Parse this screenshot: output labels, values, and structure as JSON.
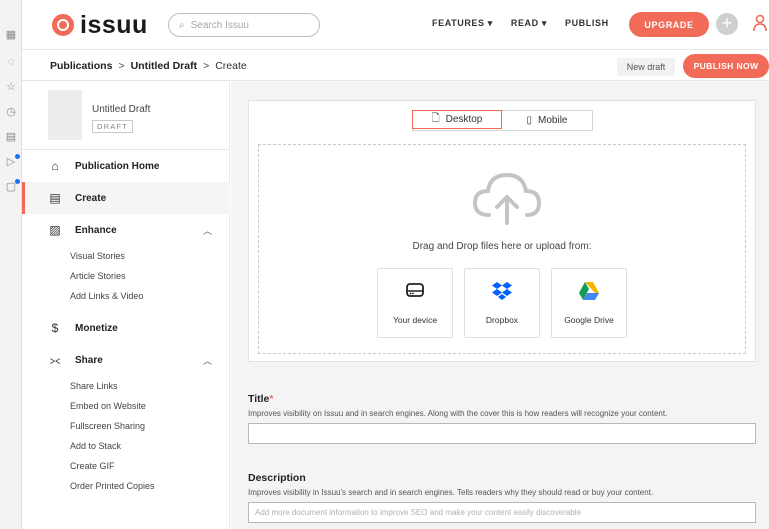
{
  "topbar": {
    "logo_text": "issuu",
    "search_placeholder": "Search Issuu",
    "nav": [
      "FEATURES ▾",
      "READ ▾",
      "PUBLISH"
    ],
    "upgrade_label": "UPGRADE",
    "plus_label": "+"
  },
  "breadcrumb": {
    "items": [
      "Publications",
      "Untitled Draft",
      "Create"
    ],
    "separator": ">"
  },
  "actions": {
    "new_draft_label": "New draft",
    "publish_label": "PUBLISH NOW"
  },
  "publication": {
    "title": "Untitled Draft",
    "badge": "DRAFT"
  },
  "nav": {
    "publication_home": "Publication Home",
    "create": "Create",
    "enhance": "Enhance",
    "enhance_items": [
      "Visual Stories",
      "Article Stories",
      "Add Links & Video"
    ],
    "monetize": "Monetize",
    "share": "Share",
    "share_items": [
      "Share Links",
      "Embed on Website",
      "Fullscreen Sharing",
      "Add to Stack",
      "Create GIF",
      "Order Printed Copies"
    ]
  },
  "upload": {
    "tabs": [
      "Desktop",
      "Mobile"
    ],
    "selected_tab": "Desktop",
    "drop_label": "Drag and Drop files here or upload from:",
    "sources": [
      "Your device",
      "Dropbox",
      "Google Drive"
    ]
  },
  "form": {
    "title_label": "Title",
    "title_required": "*",
    "title_help": "Improves visibility on Issuu and in search engines. Along with the cover this is how readers will recognize your content.",
    "title_value": "",
    "description_label": "Description",
    "description_help": "Improves visibility in Issuu's search and in search engines. Tells readers why they should read or buy your content.",
    "description_placeholder": "Add more document information to improve SEO and make your content easily discoverable"
  },
  "colors": {
    "accent": "#f26a58",
    "dropbox": "#0061ff",
    "gdrive_yellow": "#f4b400",
    "gdrive_green": "#0f9d58",
    "gdrive_blue": "#4285f4"
  }
}
